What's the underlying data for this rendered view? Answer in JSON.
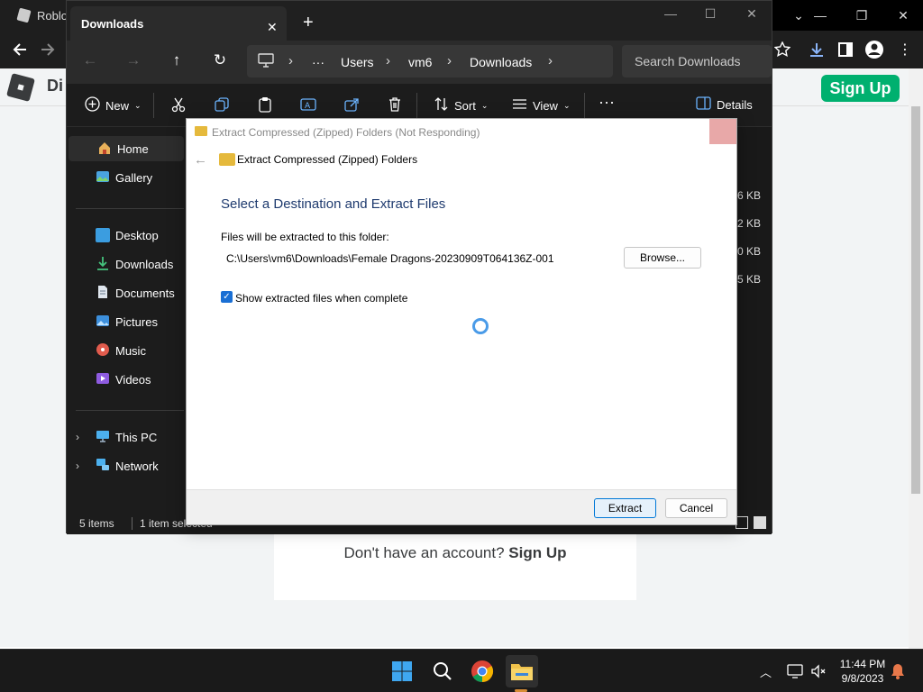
{
  "chrome": {
    "tab_title": "Roblo",
    "site_partial": "Di",
    "signup_button": "Sign Up",
    "account_prompt": "Don't have an account?",
    "account_link": "Sign Up"
  },
  "explorer": {
    "tab_title": "Downloads",
    "breadcrumbs": [
      "Users",
      "vm6",
      "Downloads"
    ],
    "search_placeholder": "Search Downloads",
    "commands": {
      "new": "New",
      "sort": "Sort",
      "view": "View",
      "details": "Details"
    },
    "sidebar": {
      "home": "Home",
      "gallery": "Gallery",
      "desktop": "Desktop",
      "downloads": "Downloads",
      "documents": "Documents",
      "pictures": "Pictures",
      "music": "Music",
      "videos": "Videos",
      "this_pc": "This PC",
      "network": "Network"
    },
    "file_sizes": [
      "6 KB",
      "2 KB",
      "0 KB",
      "5 KB"
    ],
    "status": {
      "items": "5 items",
      "selected": "1 item selected"
    }
  },
  "dialog": {
    "title": "Extract Compressed (Zipped) Folders (Not Responding)",
    "header": "Extract Compressed (Zipped) Folders",
    "heading": "Select a Destination and Extract Files",
    "path_label": "Files will be extracted to this folder:",
    "path_value": "C:\\Users\\vm6\\Downloads\\Female Dragons-20230909T064136Z-001",
    "browse_button": "Browse...",
    "checkbox_label": "Show extracted files when complete",
    "checkbox_checked": true,
    "extract_button": "Extract",
    "cancel_button": "Cancel"
  },
  "taskbar": {
    "time": "11:44 PM",
    "date": "9/8/2023"
  },
  "colors": {
    "roblox_green": "#00b06f",
    "dialog_heading": "#1e3a6e",
    "accent_blue": "#0078d7",
    "folder_yellow": "#e5b93c"
  }
}
